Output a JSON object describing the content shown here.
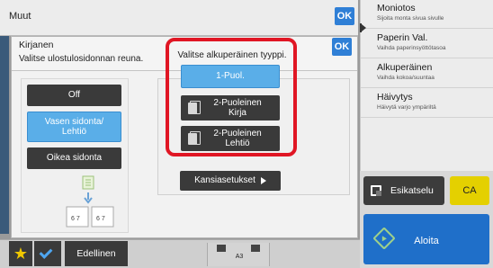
{
  "outer": {
    "title": "Muut",
    "ok_label": "OK"
  },
  "dialog": {
    "title": "Kirjanen",
    "subtitle": "Valitse ulostulosidonnan reuna.",
    "ok_label": "OK",
    "binding_options": [
      {
        "label": "Off",
        "selected": false
      },
      {
        "label": "Vasen sidonta/\nLehtiö",
        "selected": true
      },
      {
        "label": "Oikea sidonta",
        "selected": false
      }
    ],
    "illustration_labels": [
      "6 7",
      "6 7"
    ],
    "type_prompt": "Valitse alkuperäinen tyyppi.",
    "type_options": [
      {
        "label": "1-Puol.",
        "selected": true
      },
      {
        "label": "2-Puoleinen\nKirja",
        "selected": false
      },
      {
        "label": "2-Puoleinen\nLehtiö",
        "selected": false
      }
    ],
    "cover_button": "Kansiasetukset"
  },
  "right_menu": {
    "items": [
      {
        "title": "Moniotos",
        "subtitle": "Sijoita monta sivua sivulle"
      },
      {
        "title": "Paperin Val.",
        "subtitle": "Vaihda paperinsyöttötasoa"
      },
      {
        "title": "Alkuperäinen",
        "subtitle": "Vaihda kokoa/suuntaa"
      },
      {
        "title": "Häivytys",
        "subtitle": "Häivytä varjo ympäriltä"
      }
    ],
    "preview_label": "Esikatselu",
    "ca_label": "CA",
    "start_label": "Aloita"
  },
  "bottom": {
    "star_glyph": "★",
    "prev_label": "Edellinen",
    "tray_label": "A3"
  },
  "colors": {
    "accent_blue": "#2f7fd6",
    "selected_blue": "#5aaee8",
    "highlight_red": "#e01624",
    "ca_yellow": "#e4d000",
    "start_blue": "#1f6fc9"
  },
  "icons": [
    "star-icon",
    "check-icon",
    "preview-icon",
    "start-icon",
    "document-icon",
    "arrow-right-icon"
  ]
}
